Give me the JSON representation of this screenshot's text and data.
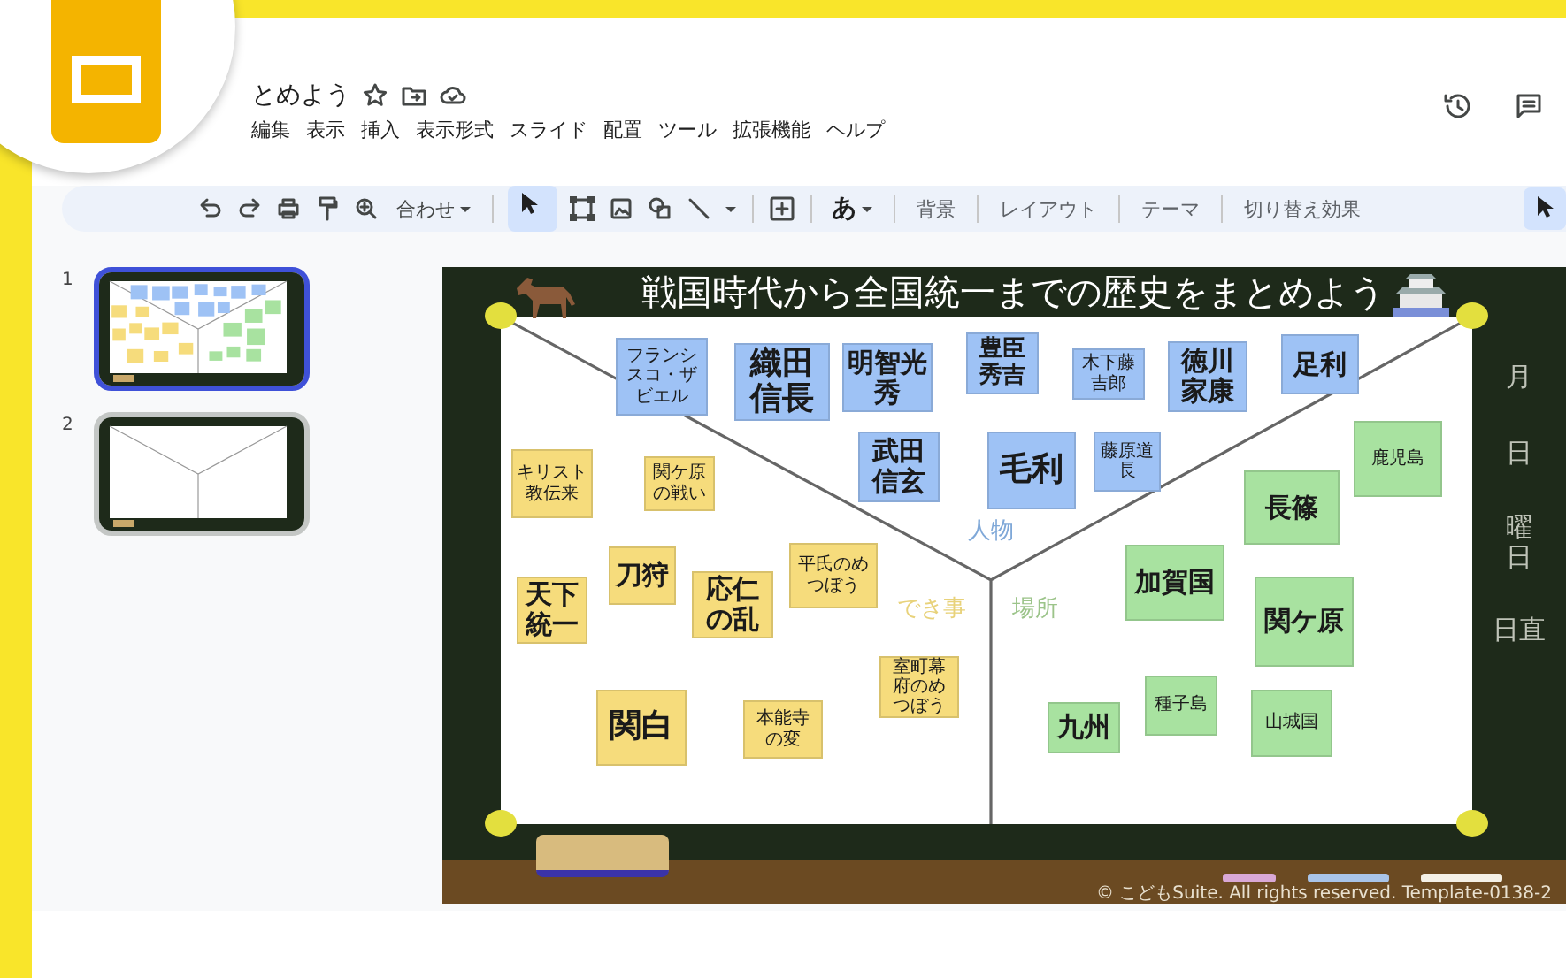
{
  "document": {
    "title": "とめよう"
  },
  "menu": [
    "編集",
    "表示",
    "挿入",
    "表示形式",
    "スライド",
    "配置",
    "ツール",
    "拡張機能",
    "ヘルプ"
  ],
  "toolbar": {
    "zoom_label": "合わせ",
    "select_tool_selected": true,
    "font_button": "あ",
    "text_buttons": [
      "背景",
      "レイアウト",
      "テーマ",
      "切り替え効果"
    ]
  },
  "slides": [
    {
      "number": "1",
      "selected": true,
      "kind": "filled"
    },
    {
      "number": "2",
      "selected": false,
      "kind": "blank"
    }
  ],
  "slide": {
    "title": "戦国時代から全国統一までの歴史をまとめよう",
    "section_labels": [
      {
        "text": "人物",
        "color": "#7fa8d8"
      },
      {
        "text": "でき事",
        "color": "#e8d27a"
      },
      {
        "text": "場所",
        "color": "#9cc48a"
      }
    ],
    "side_labels": [
      {
        "text": "月",
        "kind": "horizontal"
      },
      {
        "text": "日",
        "kind": "horizontal"
      },
      {
        "text": "曜日",
        "kind": "vertical"
      },
      {
        "text": "日直",
        "kind": "horizontal"
      }
    ],
    "copyright": "© こどもSuite. All rights reserved. Template-0138-2",
    "notes": [
      {
        "text": "フランシスコ・ザビエル",
        "color": "#9ec2f5"
      },
      {
        "text": "織田信長",
        "color": "#9ec2f5"
      },
      {
        "text": "明智光秀",
        "color": "#9ec2f5"
      },
      {
        "text": "豊臣秀吉",
        "color": "#9ec2f5"
      },
      {
        "text": "木下藤吉郎",
        "color": "#9ec2f5"
      },
      {
        "text": "徳川家康",
        "color": "#9ec2f5"
      },
      {
        "text": "足利",
        "color": "#9ec2f5"
      },
      {
        "text": "武田信玄",
        "color": "#9ec2f5"
      },
      {
        "text": "毛利",
        "color": "#9ec2f5"
      },
      {
        "text": "藤原道長",
        "color": "#9ec2f5"
      },
      {
        "text": "キリスト教伝来",
        "color": "#f6dc7c"
      },
      {
        "text": "関ケ原の戦い",
        "color": "#f6dc7c"
      },
      {
        "text": "天下統一",
        "color": "#f6dc7c"
      },
      {
        "text": "刀狩",
        "color": "#f6dc7c"
      },
      {
        "text": "応仁の乱",
        "color": "#f6dc7c"
      },
      {
        "text": "平氏のめつぼう",
        "color": "#f6dc7c"
      },
      {
        "text": "室町幕府のめつぼう",
        "color": "#f6dc7c"
      },
      {
        "text": "関白",
        "color": "#f6dc7c"
      },
      {
        "text": "本能寺の変",
        "color": "#f6dc7c"
      },
      {
        "text": "鹿児島",
        "color": "#a8e2a0"
      },
      {
        "text": "長篠",
        "color": "#a8e2a0"
      },
      {
        "text": "加賀国",
        "color": "#a8e2a0"
      },
      {
        "text": "関ケ原",
        "color": "#a8e2a0"
      },
      {
        "text": "九州",
        "color": "#a8e2a0"
      },
      {
        "text": "種子島",
        "color": "#a8e2a0"
      },
      {
        "text": "山城国",
        "color": "#a8e2a0"
      }
    ]
  }
}
